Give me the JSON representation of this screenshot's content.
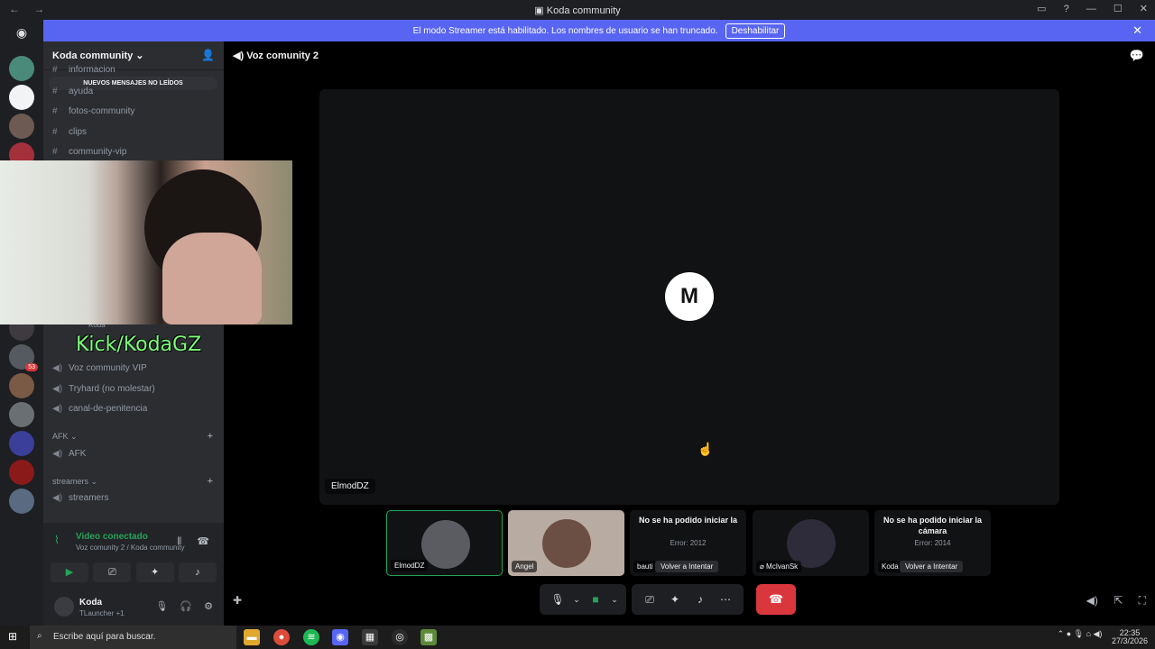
{
  "window": {
    "title": "Koda community",
    "back_icon": "←",
    "fwd_icon": "→"
  },
  "banner": {
    "text": "El modo Streamer está habilitado. Los nombres de usuario se han truncado.",
    "button": "Deshabilitar"
  },
  "server": {
    "name": "Koda community",
    "unread_pill": "NUEVOS MENSAJES NO LEÍDOS"
  },
  "channels": {
    "informacion": "informacion",
    "ayuda": "ayuda",
    "fotos": "fotos-community",
    "clips": "clips",
    "vip": "community-vip",
    "voz_vip": "Voz community VIP",
    "tryhard": "Tryhard (no molestar)",
    "penitencia": "canal-de-penitencia",
    "afk": "AFK",
    "streamers": "streamers",
    "koda_member": "Koda"
  },
  "categories": {
    "afk": "AFK",
    "streamers": "streamers"
  },
  "guild_badges": {
    "mention_count": "53"
  },
  "voice_panel": {
    "status": "Video conectado",
    "sub": "Voz comunity 2 / Koda community"
  },
  "user": {
    "name": "Koda",
    "sub": "TLauncher +1"
  },
  "overlay": {
    "kick": "Kick/KodaGZ"
  },
  "voice_header": {
    "channel": "Voz comunity 2"
  },
  "stage": {
    "label": "ElmodDZ"
  },
  "tiles": {
    "t1": {
      "label": "ElmodDZ"
    },
    "t2": {
      "label": "Angel"
    },
    "t3": {
      "error": "No se ha podido iniciar la",
      "code": "Error: 2012",
      "name": "bauti",
      "retry": "Volver a Intentar"
    },
    "t4": {
      "label": "McIvanSk"
    },
    "t5": {
      "error": "No se ha podido iniciar la cámara",
      "code": "Error: 2014",
      "name": "Koda",
      "retry": "Volver a Intentar"
    }
  },
  "taskbar": {
    "search": "Escribe aquí para buscar.",
    "time": "22:35",
    "date": "27/3/2026"
  },
  "colors": {
    "accent": "#5865f2",
    "green": "#23a559",
    "hangup": "#da373c"
  },
  "icons": [
    "discord-icon",
    "speaker-icon",
    "mic-icon",
    "camera-icon",
    "screen-share-icon",
    "activity-icon",
    "soundboard-icon",
    "more-icon",
    "hangup-icon"
  ]
}
